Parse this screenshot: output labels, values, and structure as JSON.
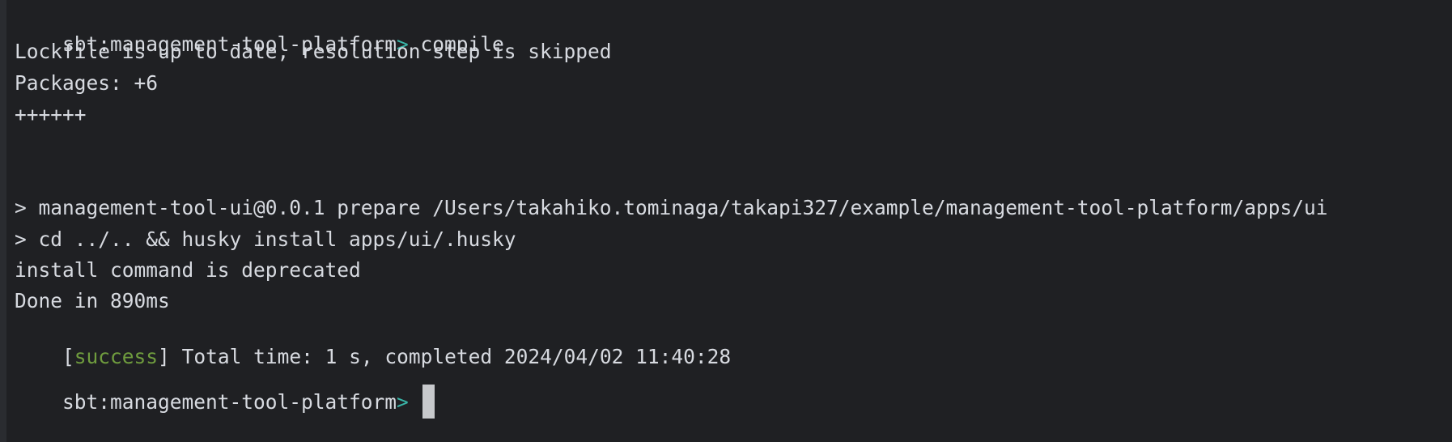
{
  "terminal": {
    "lines": {
      "l1": {
        "prompt": "sbt:management-tool-platform",
        "arrow": ">",
        "command": " compile"
      },
      "l2": "Lockfile is up to date, resolution step is skipped",
      "l3": "Packages: +6",
      "l4": "++++++",
      "l5": "> management-tool-ui@0.0.1 prepare /Users/takahiko.tominaga/takapi327/example/management-tool-platform/apps/ui",
      "l6": "> cd ../.. && husky install apps/ui/.husky",
      "l7": "install command is deprecated",
      "l8": "Done in 890ms",
      "l9": {
        "open_bracket": "[",
        "status": "success",
        "close_bracket": "]",
        "message": " Total time: 1 s, completed 2024/04/02 11:40:28"
      },
      "l10": {
        "prompt": "sbt:management-tool-platform",
        "arrow": ">"
      }
    },
    "colors": {
      "background": "#1f2023",
      "text": "#d7dae0",
      "prompt_arrow": "#39b5a8",
      "success": "#6f9c3e",
      "cursor": "#c7c9cc"
    }
  }
}
